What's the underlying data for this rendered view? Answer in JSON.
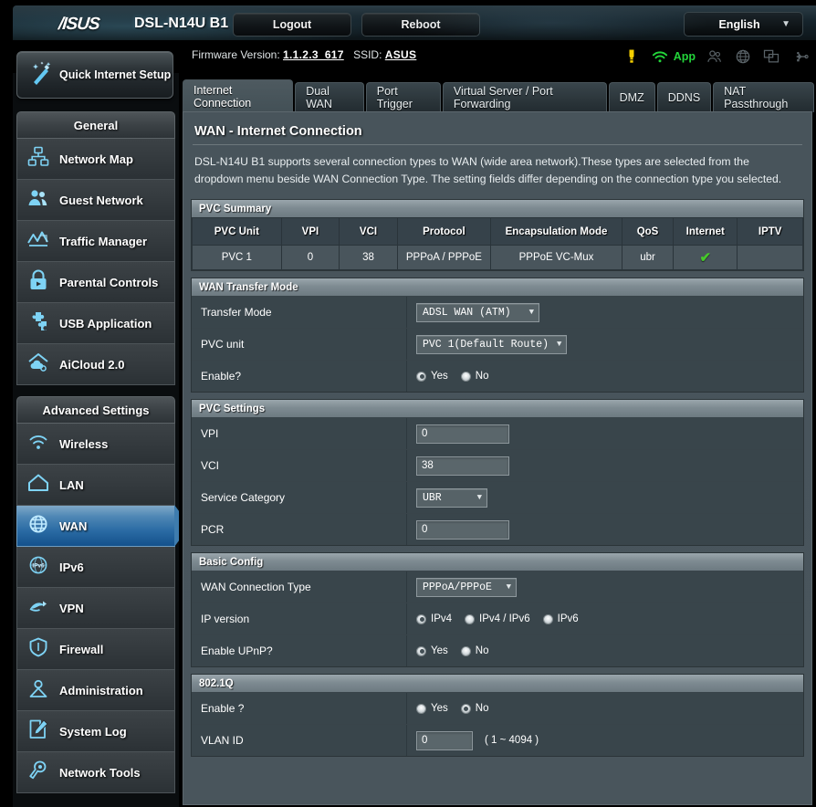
{
  "header": {
    "brand": "/ISUS",
    "model": "DSL-N14U B1",
    "logout_label": "Logout",
    "reboot_label": "Reboot",
    "language": "English",
    "firmware_label": "Firmware Version:",
    "firmware_version": "1.1.2.3_617",
    "ssid_label": "SSID:",
    "ssid_value": "ASUS",
    "app_label": "App",
    "icons": [
      "warning-lamp-icon",
      "wifi-icon",
      "guest-users-icon",
      "globe-icon",
      "devices-icon",
      "usb-icon"
    ]
  },
  "sidebar": {
    "quick_setup": "Quick Internet Setup",
    "groups": [
      {
        "title": "General",
        "items": [
          {
            "label": "Network Map",
            "icon": "network-map-icon",
            "active": false
          },
          {
            "label": "Guest Network",
            "icon": "guest-network-icon",
            "active": false
          },
          {
            "label": "Traffic Manager",
            "icon": "traffic-manager-icon",
            "active": false
          },
          {
            "label": "Parental Controls",
            "icon": "parental-controls-icon",
            "active": false
          },
          {
            "label": "USB Application",
            "icon": "usb-application-icon",
            "active": false
          },
          {
            "label": "AiCloud 2.0",
            "icon": "aicloud-icon",
            "active": false
          }
        ]
      },
      {
        "title": "Advanced Settings",
        "items": [
          {
            "label": "Wireless",
            "icon": "wireless-icon",
            "active": false
          },
          {
            "label": "LAN",
            "icon": "lan-home-icon",
            "active": false
          },
          {
            "label": "WAN",
            "icon": "wan-globe-icon",
            "active": true
          },
          {
            "label": "IPv6",
            "icon": "ipv6-icon",
            "active": false
          },
          {
            "label": "VPN",
            "icon": "vpn-icon",
            "active": false
          },
          {
            "label": "Firewall",
            "icon": "firewall-shield-icon",
            "active": false
          },
          {
            "label": "Administration",
            "icon": "administration-icon",
            "active": false
          },
          {
            "label": "System Log",
            "icon": "system-log-icon",
            "active": false
          },
          {
            "label": "Network Tools",
            "icon": "network-tools-icon",
            "active": false
          }
        ]
      }
    ]
  },
  "tabs": [
    {
      "label": "Internet Connection",
      "active": true
    },
    {
      "label": "Dual WAN",
      "active": false
    },
    {
      "label": "Port Trigger",
      "active": false
    },
    {
      "label": "Virtual Server / Port Forwarding",
      "active": false
    },
    {
      "label": "DMZ",
      "active": false
    },
    {
      "label": "DDNS",
      "active": false
    },
    {
      "label": "NAT Passthrough",
      "active": false
    }
  ],
  "page": {
    "title": "WAN - Internet Connection",
    "description": "DSL-N14U B1 supports several connection types to WAN (wide area network).These types are selected from the dropdown menu beside WAN Connection Type. The setting fields differ depending on the connection type you selected."
  },
  "pvc_summary": {
    "section_title": "PVC Summary",
    "columns": [
      "PVC Unit",
      "VPI",
      "VCI",
      "Protocol",
      "Encapsulation Mode",
      "QoS",
      "Internet",
      "IPTV"
    ],
    "rows": [
      {
        "pvc_unit": "PVC 1",
        "vpi": "0",
        "vci": "38",
        "protocol": "PPPoA / PPPoE",
        "encapsulation_mode": "PPPoE VC-Mux",
        "qos": "ubr",
        "internet": "✔",
        "iptv": ""
      }
    ]
  },
  "wan_transfer_mode": {
    "section_title": "WAN Transfer Mode",
    "transfer_mode_label": "Transfer Mode",
    "transfer_mode_value": "ADSL WAN (ATM)",
    "pvc_unit_label": "PVC unit",
    "pvc_unit_value": "PVC 1(Default Route)",
    "enable_label": "Enable?",
    "enable_yes": "Yes",
    "enable_no": "No",
    "enable_selected": "Yes"
  },
  "pvc_settings": {
    "section_title": "PVC Settings",
    "vpi_label": "VPI",
    "vpi_value": "0",
    "vci_label": "VCI",
    "vci_value": "38",
    "service_category_label": "Service Category",
    "service_category_value": "UBR",
    "pcr_label": "PCR",
    "pcr_value": "0"
  },
  "basic_config": {
    "section_title": "Basic Config",
    "wan_connection_type_label": "WAN Connection Type",
    "wan_connection_type_value": "PPPoA/PPPoE",
    "ip_version_label": "IP version",
    "ip_version_options": [
      "IPv4",
      "IPv4 / IPv6",
      "IPv6"
    ],
    "ip_version_selected": "IPv4",
    "upnp_label": "Enable UPnP?",
    "upnp_yes": "Yes",
    "upnp_no": "No",
    "upnp_selected": "Yes"
  },
  "vlan_8021q": {
    "section_title": "802.1Q",
    "enable_label": "Enable ?",
    "enable_yes": "Yes",
    "enable_no": "No",
    "enable_selected": "No",
    "vlan_id_label": "VLAN ID",
    "vlan_id_value": "0",
    "vlan_id_hint": "( 1 ~ 4094 )"
  },
  "colors": {
    "accent": "#2a6ba4",
    "success": "#46c82b",
    "app_green": "#23d43a",
    "panel": "#49555c",
    "row": "#39454b"
  }
}
